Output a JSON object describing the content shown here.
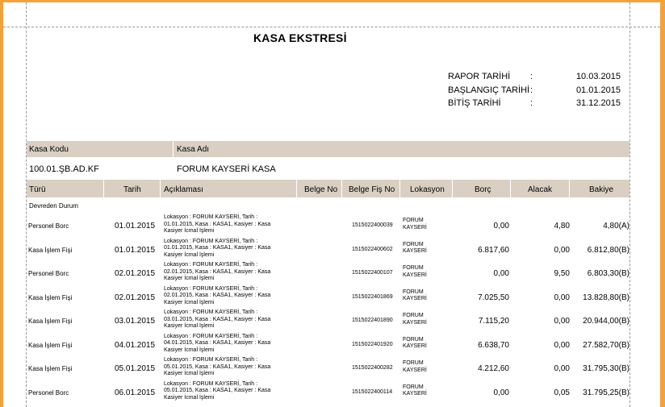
{
  "report": {
    "title": "KASA EKSTRESİ",
    "meta": [
      {
        "label": "RAPOR TARİHİ",
        "value": "10.03.2015"
      },
      {
        "label": "BAŞLANGIÇ TARİHİ",
        "value": "01.01.2015"
      },
      {
        "label": "BİTİŞ TARİHİ",
        "value": "31.12.2015"
      }
    ],
    "colon": ":"
  },
  "kasa": {
    "code_label": "Kasa Kodu",
    "name_label": "Kasa Adı",
    "code": "100.01.ŞB.AD.KF",
    "name": "FORUM KAYSERİ KASA"
  },
  "columns": [
    "Türü",
    "Tarih",
    "Açıklaması",
    "Belge No",
    "Belge Fiş No",
    "Lokasyon",
    "Borç",
    "Alacak",
    "Bakiye"
  ],
  "devreden": "Devreden Durum",
  "rows": [
    {
      "turu": "Personel Borc",
      "tarih": "01.01.2015",
      "aciklama": [
        "Lokasyon : FORUM KAYSERİ, Tarih :",
        "01.01.2015, Kasa : KASA1, Kasiyer :  Kasa",
        "Kasiyer İcmal İşlemi"
      ],
      "fis": "1515022400039",
      "lok": [
        "FORUM",
        "KAYSERİ"
      ],
      "borc": "0,00",
      "alacak": "4,80",
      "bakiye": "4,80(A)"
    },
    {
      "turu": "Kasa İşlem Fişi",
      "tarih": "01.01.2015",
      "aciklama": [
        "Lokasyon : FORUM KAYSERİ, Tarih :",
        "01.01.2015, Kasa : KASA1, Kasiyer :  Kasa",
        "Kasiyer İcmal İşlemi"
      ],
      "fis": "1515022400602",
      "lok": [
        "FORUM",
        "KAYSERİ"
      ],
      "borc": "6.817,60",
      "alacak": "0,00",
      "bakiye": "6.812,80(B)"
    },
    {
      "turu": "Personel Borc",
      "tarih": "02.01.2015",
      "aciklama": [
        "Lokasyon : FORUM KAYSERİ, Tarih :",
        "02.01.2015, Kasa : KASA1, Kasiyer :  Kasa",
        "Kasiyer İcmal İşlemi"
      ],
      "fis": "1515022400107",
      "lok": [
        "FORUM",
        "KAYSERİ"
      ],
      "borc": "0,00",
      "alacak": "9,50",
      "bakiye": "6.803,30(B)"
    },
    {
      "turu": "Kasa İşlem Fişi",
      "tarih": "02.01.2015",
      "aciklama": [
        "Lokasyon : FORUM KAYSERİ, Tarih :",
        "02.01.2015, Kasa : KASA1, Kasiyer :  Kasa",
        "Kasiyer İcmal İşlemi"
      ],
      "fis": "1515022401869",
      "lok": [
        "FORUM",
        "KAYSERİ"
      ],
      "borc": "7.025,50",
      "alacak": "0,00",
      "bakiye": "13.828,80(B)"
    },
    {
      "turu": "Kasa İşlem Fişi",
      "tarih": "03.01.2015",
      "aciklama": [
        "Lokasyon : FORUM KAYSERİ, Tarih :",
        "03.01.2015, Kasa : KASA1, Kasiyer :  Kasa",
        "Kasiyer İcmal İşlemi"
      ],
      "fis": "1515022401890",
      "lok": [
        "FORUM",
        "KAYSERİ"
      ],
      "borc": "7.115,20",
      "alacak": "0,00",
      "bakiye": "20.944,00(B)"
    },
    {
      "turu": "Kasa İşlem Fişi",
      "tarih": "04.01.2015",
      "aciklama": [
        "Lokasyon : FORUM KAYSERİ, Tarih :",
        "04.01.2015, Kasa : KASA1, Kasiyer :  Kasa",
        "Kasiyer İcmal İşlemi"
      ],
      "fis": "1515022401920",
      "lok": [
        "FORUM",
        "KAYSERİ"
      ],
      "borc": "6.638,70",
      "alacak": "0,00",
      "bakiye": "27.582,70(B)"
    },
    {
      "turu": "Kasa İşlem Fişi",
      "tarih": "05.01.2015",
      "aciklama": [
        "Lokasyon : FORUM KAYSERİ, Tarih :",
        "05.01.2015, Kasa : KASA1, Kasiyer :  Kasa",
        "Kasiyer İcmal İşlemi"
      ],
      "fis": "1515022400282",
      "lok": [
        "FORUM",
        "KAYSERİ"
      ],
      "borc": "4.212,60",
      "alacak": "0,00",
      "bakiye": "31.795,30(B)"
    },
    {
      "turu": "Personel Borc",
      "tarih": "06.01.2015",
      "aciklama": [
        "Lokasyon : FORUM KAYSERİ, Tarih :",
        "05.01.2015, Kasa : KASA1, Kasiyer :  Kasa",
        "Kasiyer İcmal İşlemi"
      ],
      "fis": "1515022400114",
      "lok": [
        "FORUM",
        "KAYSERİ"
      ],
      "borc": "0,00",
      "alacak": "0,05",
      "bakiye": "31.795,25(B)"
    }
  ]
}
